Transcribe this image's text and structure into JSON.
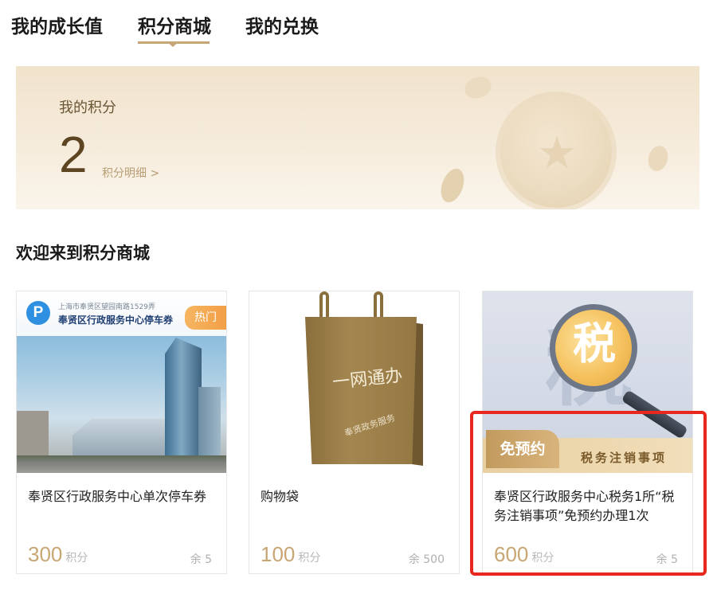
{
  "tabs": [
    {
      "label": "我的成长值",
      "active": false
    },
    {
      "label": "积分商城",
      "active": true
    },
    {
      "label": "我的兑换",
      "active": false
    }
  ],
  "points": {
    "label": "我的积分",
    "value": "2",
    "detail_link": "积分明细 >"
  },
  "section_title": "欢迎来到积分商城",
  "products": [
    {
      "title": "奉贤区行政服务中心单次停车券",
      "price": "300",
      "unit": "积分",
      "stock": "余 5",
      "image": {
        "address": "上海市奉贤区望园南路1529弄",
        "name": "奉贤区行政服务中心停车券",
        "badge": "热门",
        "icon": "P"
      }
    },
    {
      "title": "购物袋",
      "price": "100",
      "unit": "积分",
      "stock": "余 500",
      "image": {
        "text_main": "一网通办",
        "text_sub": "奉贤政务服务"
      }
    },
    {
      "title": "奉贤区行政服务中心税务1所“税务注销事项”免预约办理1次",
      "price": "600",
      "unit": "积分",
      "stock": "余 5",
      "image": {
        "big_char": "税",
        "lens_char": "税",
        "badge": "免预约",
        "tag": "税务注销事项"
      }
    }
  ],
  "colors": {
    "accent": "#c7a777",
    "price": "#c8a673",
    "highlight": "#e8281f"
  }
}
